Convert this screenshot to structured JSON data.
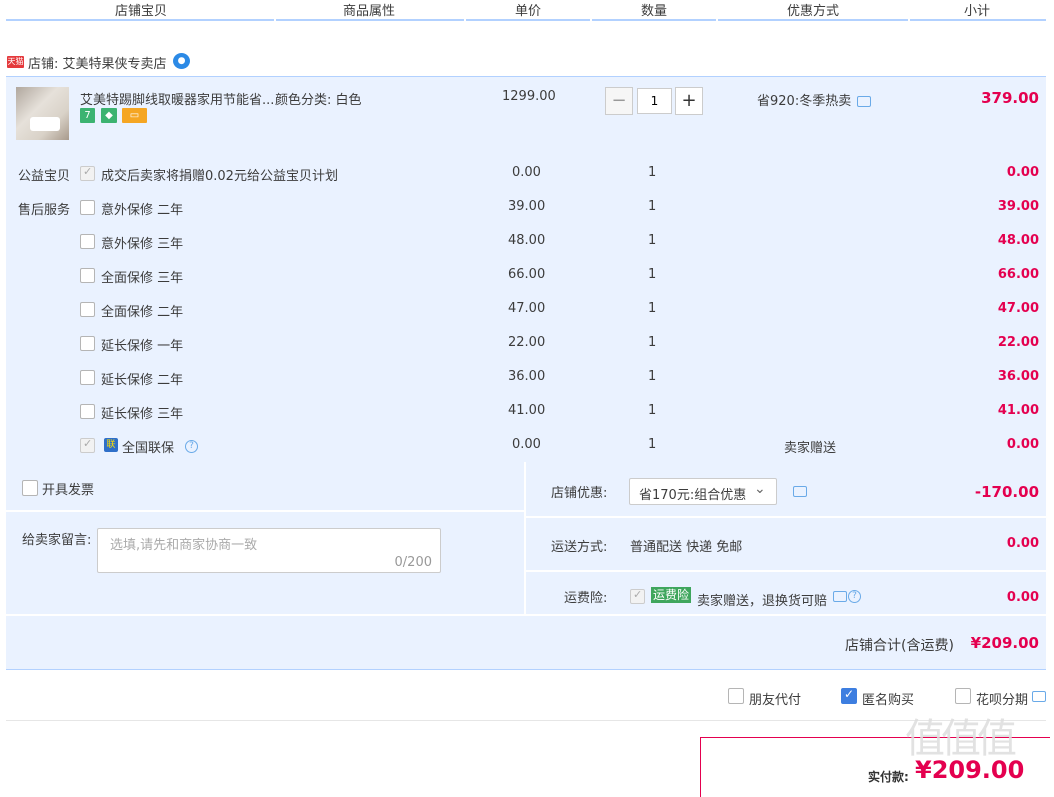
{
  "header": {
    "columns": [
      "店铺宝贝",
      "商品属性",
      "单价",
      "数量",
      "优惠方式",
      "小计"
    ]
  },
  "shop": {
    "label": "店铺:",
    "name": "艾美特果侠专卖店",
    "tmall_badge": "天猫",
    "ww_icon": "wangwang-icon"
  },
  "item": {
    "title": "艾美特踢脚线取暖器家用节能省...",
    "attribute": "颜色分类: 白色",
    "unit_price": "1299.00",
    "quantity": "1",
    "minus": "−",
    "plus": "+",
    "promotion": "省920:冬季热卖",
    "subtotal": "379.00",
    "badges": [
      "7",
      "guarantee-icon",
      "card-icon"
    ]
  },
  "charity": {
    "label": "公益宝贝",
    "text": "成交后卖家将捐赠0.02元给公益宝贝计划",
    "price": "0.00",
    "qty": "1",
    "subtotal": "0.00"
  },
  "services": {
    "label": "售后服务",
    "rows": [
      {
        "name": "意外保修 二年",
        "price": "39.00",
        "qty": "1",
        "subtotal": "39.00"
      },
      {
        "name": "意外保修 三年",
        "price": "48.00",
        "qty": "1",
        "subtotal": "48.00"
      },
      {
        "name": "全面保修 三年",
        "price": "66.00",
        "qty": "1",
        "subtotal": "66.00"
      },
      {
        "name": "全面保修 二年",
        "price": "47.00",
        "qty": "1",
        "subtotal": "47.00"
      },
      {
        "name": "延长保修 一年",
        "price": "22.00",
        "qty": "1",
        "subtotal": "22.00"
      },
      {
        "name": "延长保修 二年",
        "price": "36.00",
        "qty": "1",
        "subtotal": "36.00"
      },
      {
        "name": "延长保修 三年",
        "price": "41.00",
        "qty": "1",
        "subtotal": "41.00"
      }
    ],
    "national": {
      "name": "全国联保",
      "price": "0.00",
      "qty": "1",
      "promo": "卖家赠送",
      "subtotal": "0.00"
    }
  },
  "invoice": {
    "label": "开具发票"
  },
  "message": {
    "label": "给卖家留言:",
    "placeholder": "选填,请先和商家协商一致",
    "counter": "0/200"
  },
  "shop_discount": {
    "label": "店铺优惠:",
    "selected": "省170元:组合优惠",
    "value": "-170.00"
  },
  "shipping": {
    "label": "运送方式:",
    "text": "普通配送 快递 免邮",
    "value": "0.00"
  },
  "freight_insurance": {
    "label": "运费险:",
    "badge": "运费险",
    "text": "卖家赠送，退换货可赔",
    "value": "0.00"
  },
  "shop_total": {
    "label": "店铺合计(含运费)",
    "value": "¥209.00"
  },
  "options": {
    "friend_pay": "朋友代付",
    "anonymous": "匿名购买",
    "huabei": "花呗分期"
  },
  "pay": {
    "label": "实付款:",
    "value": "¥209.00"
  },
  "watermark": "值值值"
}
